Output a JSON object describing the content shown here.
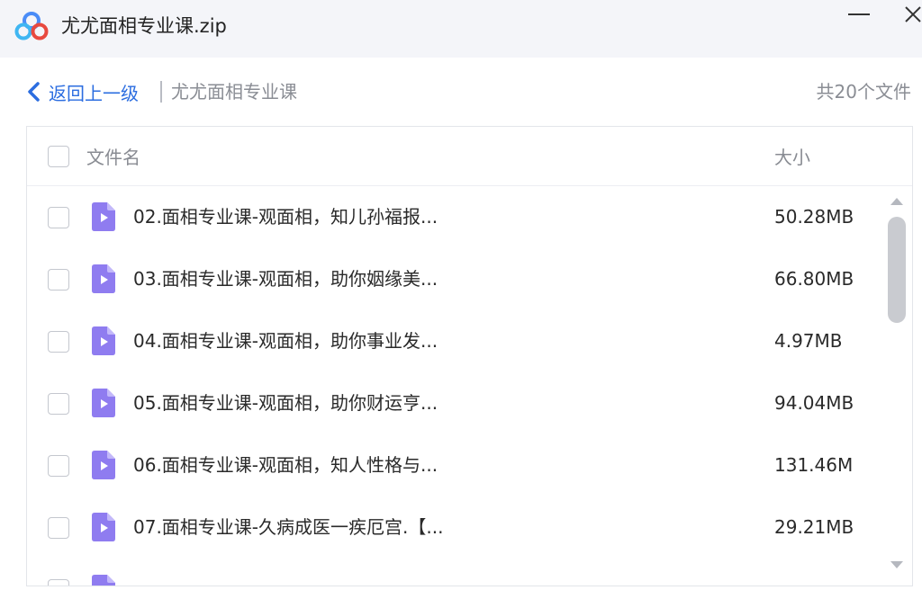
{
  "window": {
    "title": "尤尤面相专业课.zip",
    "logo_icon": "baidu-netdisk-cloud-icon",
    "minimize_icon": "minimize-icon",
    "close_icon": "close-icon"
  },
  "nav": {
    "back_label": "返回上一级",
    "back_icon": "chevron-left-icon",
    "current_folder": "尤尤面相专业课",
    "file_count": "共20个文件"
  },
  "list": {
    "header": {
      "name": "文件名",
      "size": "大小"
    },
    "files": [
      {
        "name": "02.面相专业课-观面相，知儿孙福报...",
        "size": "50.28MB",
        "icon": "video-file-icon"
      },
      {
        "name": "03.面相专业课-观面相，助你姻缘美...",
        "size": "66.80MB",
        "icon": "video-file-icon"
      },
      {
        "name": "04.面相专业课-观面相，助你事业发...",
        "size": "4.97MB",
        "icon": "video-file-icon"
      },
      {
        "name": "05.面相专业课-观面相，助你财运亨...",
        "size": "94.04MB",
        "icon": "video-file-icon"
      },
      {
        "name": "06.面相专业课-观面相，知人性格与...",
        "size": "131.46M",
        "icon": "video-file-icon"
      },
      {
        "name": "07.面相专业课-久病成医一疾厄宫.【...",
        "size": "29.21MB",
        "icon": "video-file-icon"
      }
    ]
  },
  "colors": {
    "accent": "#2b6de0",
    "file_icon": "#8f7cf0",
    "titlebar_bg": "#f4f5f9"
  }
}
